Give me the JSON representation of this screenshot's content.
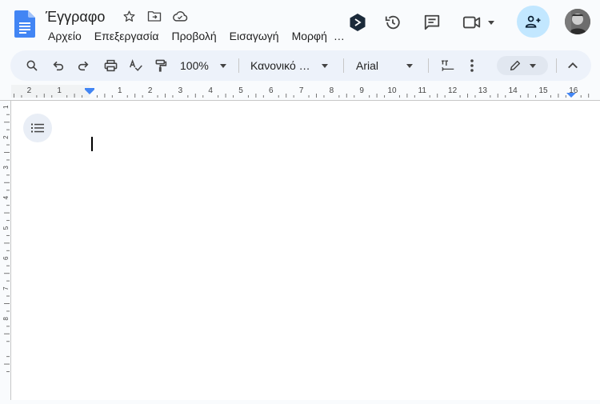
{
  "header": {
    "title": "Έγγραφο",
    "menu": [
      "Αρχείο",
      "Επεξεργασία",
      "Προβολή",
      "Εισαγωγή",
      "Μορφή"
    ],
    "menu_more": "…"
  },
  "toolbar": {
    "zoom": "100%",
    "style": "Κανονικό …",
    "font": "Arial"
  },
  "ruler": {
    "labels": [
      "2",
      "1",
      "1",
      "2",
      "3",
      "4",
      "5",
      "6",
      "7",
      "8",
      "9",
      "10",
      "11",
      "12",
      "13",
      "14",
      "15",
      "16"
    ]
  },
  "vruler": {
    "labels": [
      "1",
      "2",
      "3",
      "4",
      "5",
      "6",
      "7",
      "8"
    ]
  },
  "colors": {
    "docs_blue": "#4285f4",
    "share_bg": "#c2e7ff",
    "toolbar_bg": "#edf2fa",
    "background": "#f9fbfd"
  }
}
